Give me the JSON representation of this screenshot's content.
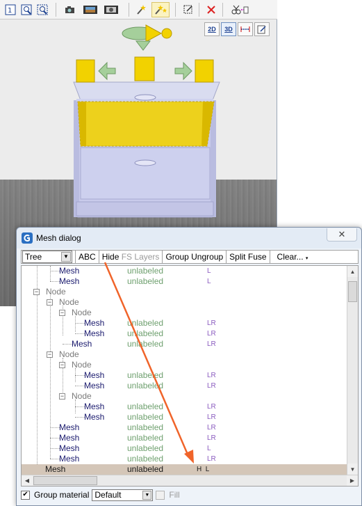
{
  "editor": {
    "view_buttons": [
      "2D",
      "3D"
    ],
    "toolbar_icons": [
      "select-1-icon",
      "zoom-window-icon",
      "zoom-extents-icon",
      "camera-icon",
      "film-icon",
      "film-view-icon",
      "magic-wand-icon",
      "magic-wand-multi-icon",
      "resize-icon",
      "delete-icon",
      "cut-icon"
    ]
  },
  "dialog": {
    "title": "Mesh dialog",
    "close_label": "✕",
    "toolbar": {
      "view_mode": "Tree",
      "abc": "ABC",
      "hide": "Hide",
      "fs": "FS",
      "layers": "Layers",
      "group": "Group",
      "ungroup": "Ungroup",
      "split": "Split",
      "fuse": "Fuse",
      "clear": "Clear..."
    },
    "tree": [
      {
        "name": "Mesh",
        "label": "unlabeled",
        "flags": "L"
      },
      {
        "name": "Mesh",
        "label": "unlabeled",
        "flags": "L"
      },
      {
        "name": "Node",
        "label": "",
        "flags": ""
      },
      {
        "name": "Node",
        "label": "",
        "flags": ""
      },
      {
        "name": "Node",
        "label": "",
        "flags": ""
      },
      {
        "name": "Mesh",
        "label": "unlabeled",
        "flags": "LR"
      },
      {
        "name": "Mesh",
        "label": "unlabeled",
        "flags": "LR"
      },
      {
        "name": "Mesh",
        "label": "unlabeled",
        "flags": "LR"
      },
      {
        "name": "Node",
        "label": "",
        "flags": ""
      },
      {
        "name": "Node",
        "label": "",
        "flags": ""
      },
      {
        "name": "Mesh",
        "label": "unlabeled",
        "flags": "LR"
      },
      {
        "name": "Mesh",
        "label": "unlabeled",
        "flags": "LR"
      },
      {
        "name": "Node",
        "label": "",
        "flags": ""
      },
      {
        "name": "Mesh",
        "label": "unlabeled",
        "flags": "LR"
      },
      {
        "name": "Mesh",
        "label": "unlabeled",
        "flags": "LR"
      },
      {
        "name": "Mesh",
        "label": "unlabeled",
        "flags": "LR"
      },
      {
        "name": "Mesh",
        "label": "unlabeled",
        "flags": "LR"
      },
      {
        "name": "Mesh",
        "label": "unlabeled",
        "flags": "L"
      },
      {
        "name": "Mesh",
        "label": "unlabeled",
        "flags": "LR"
      },
      {
        "name": "Mesh",
        "label": "unlabeled",
        "flags": "H  L",
        "selected": true
      }
    ],
    "bottom": {
      "group_material_label": "Group material",
      "group_material_checked": true,
      "material_value": "Default",
      "fill_label": "Fill",
      "fill_checked": false
    }
  },
  "colors": {
    "selection": "#d4c6b8",
    "label_green": "#6fa06f",
    "flag_purple": "#8a5bbf",
    "annotation_arrow": "#f0642a",
    "gizmo_yellow": "#f2d200"
  }
}
